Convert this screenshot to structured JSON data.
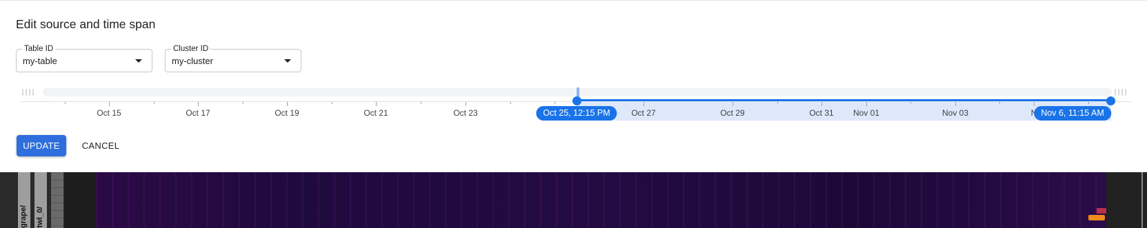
{
  "dialog": {
    "title": "Edit source and time span",
    "table_field": {
      "label": "Table ID",
      "value": "my-table"
    },
    "cluster_field": {
      "label": "Cluster ID",
      "value": "my-cluster"
    },
    "timeline": {
      "tick_labels": [
        "Oct 15",
        "Oct 17",
        "Oct 19",
        "Oct 21",
        "Oct 23",
        "Oct 27",
        "Oct 29",
        "Oct 31",
        "Nov 01",
        "Nov 03",
        "N"
      ],
      "range_start_label": "Oct 25, 12:15 PM",
      "range_end_label": "Nov 6, 11:15 AM",
      "accent_color": "#1a73e8"
    },
    "update_label": "UPDATE",
    "cancel_label": "CANCEL"
  },
  "visualization": {
    "column_labels": [
      "grape/",
      "twl_0/"
    ]
  }
}
